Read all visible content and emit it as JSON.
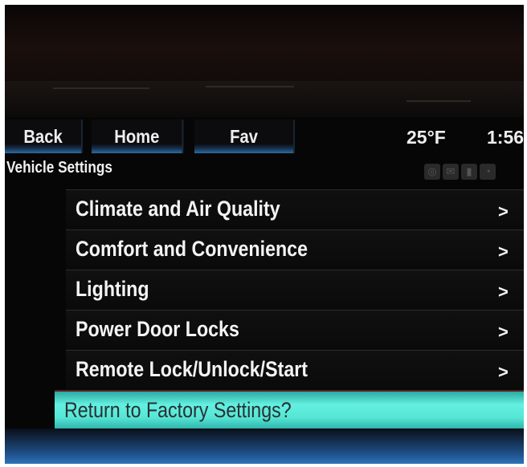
{
  "nav": {
    "back_label": "Back",
    "home_label": "Home",
    "fav_label": "Fav"
  },
  "status": {
    "temperature": "25°F",
    "time": "1:56"
  },
  "page_title": "Vehicle Settings",
  "menu": {
    "items": [
      {
        "label": "Climate and Air Quality",
        "chevron": ">"
      },
      {
        "label": "Comfort and Convenience",
        "chevron": ">"
      },
      {
        "label": "Lighting",
        "chevron": ">"
      },
      {
        "label": "Power Door Locks",
        "chevron": ">"
      },
      {
        "label": "Remote Lock/Unlock/Start",
        "chevron": ">"
      },
      {
        "label": "Return to Factory Settings?"
      }
    ],
    "selected_index": 5
  },
  "colors": {
    "selection": "#56e6d6",
    "nav_accent": "#2d6da0",
    "background": "#0a0a0a"
  }
}
